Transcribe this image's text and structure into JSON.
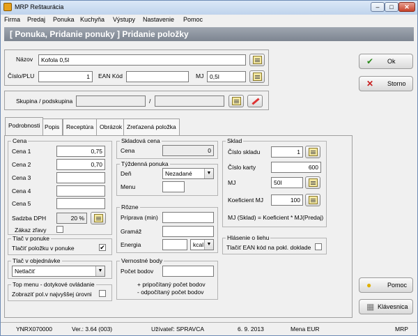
{
  "window": {
    "title": "MRP Reštaurácia",
    "min": "–",
    "max": "□",
    "close": "✕"
  },
  "menu": [
    "Firma",
    "Predaj",
    "Ponuka",
    "Kuchyňa",
    "Výstupy",
    "Nastavenie",
    "Pomoc"
  ],
  "header": "[ Ponuka, Pridanie ponuky ] Pridanie položky",
  "item": {
    "nazov_label": "Názov",
    "nazov": "Kofola 0,5l",
    "cislo_label": "Číslo/PLU",
    "cislo": "1",
    "ean_label": "EAN Kód",
    "ean": "",
    "mj_label": "MJ",
    "mj": "0,5l"
  },
  "skupina": {
    "label": "Skupina / podskupina",
    "sep": "/",
    "skupina": "",
    "podskupina": ""
  },
  "buttons": {
    "ok": "Ok",
    "storno": "Storno",
    "pomoc": "Pomoc",
    "klavesnica": "Klávesnica"
  },
  "tabs": [
    "Podrobnosti",
    "Popis",
    "Receptúra",
    "Obrázok",
    "Zreťazená položka"
  ],
  "cena": {
    "legend": "Cena",
    "labels": [
      "Cena 1",
      "Cena 2",
      "Cena 3",
      "Cena 4",
      "Cena 5"
    ],
    "values": [
      "0,75",
      "0,70",
      "",
      "",
      ""
    ],
    "dph_label": "Sadzba DPH",
    "dph": "20 %",
    "zakaz_label": "Zákaz zľavy"
  },
  "tlac_ponuke": {
    "legend": "Tlač v ponuke",
    "label": "Tlačiť položku v ponuke",
    "checked": "✔"
  },
  "tlac_obj": {
    "legend": "Tlač v objednávke",
    "value": "Netlačiť"
  },
  "topmenu": {
    "legend": "Top menu - dotykové ovládanie",
    "label": "Zobraziť pol.v najvyššej úrovni"
  },
  "skladova": {
    "legend": "Skladová cena",
    "label": "Cena",
    "value": "0"
  },
  "tyzdenna": {
    "legend": "Týždenná ponuka",
    "den_label": "Deň",
    "den": "Nezadané",
    "menu_label": "Menu",
    "menu": ""
  },
  "rozne": {
    "legend": "Rôzne",
    "priprava_label": "Príprava (min)",
    "gramaz_label": "Gramáž",
    "energia_label": "Energia",
    "energia_unit": "kcal"
  },
  "vernostne": {
    "legend": "Vernostné body",
    "pocet_label": "Počet bodov",
    "plus": "+ pripočítaný počet bodov",
    "minus": "- odpočítaný počet bodov"
  },
  "sklad": {
    "legend": "Sklad",
    "cislo_label": "Číslo skladu",
    "cislo": "1",
    "karta_label": "Číslo karty",
    "karta": "600",
    "mj_label": "MJ",
    "mj": "50l",
    "koef_label": "Koeficient MJ",
    "koef": "100",
    "formula": "MJ (Sklad) = Koeficient * MJ(Predaj)"
  },
  "liehu": {
    "legend": "Hlásenie o liehu",
    "label": "Tlačiť EAN kód na pokl. doklade"
  },
  "status": {
    "code": "YNRX070000",
    "ver": "Ver.: 3.64 (003)",
    "user": "Užívateľ: SPRAVCA",
    "date": "6. 9. 2013",
    "mena": "Mena EUR",
    "mrp": "MRP"
  }
}
